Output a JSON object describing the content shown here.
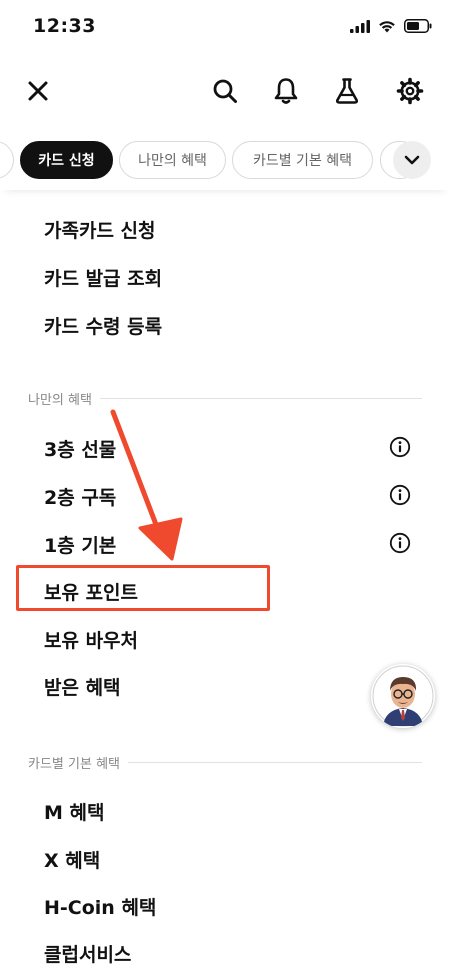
{
  "status_bar": {
    "time": "12:33"
  },
  "top_bar": {
    "icons": [
      "close-icon",
      "search-icon",
      "bell-icon",
      "flask-icon",
      "gear-icon"
    ]
  },
  "chips": {
    "items": [
      {
        "label": "카드 신청",
        "active": true
      },
      {
        "label": "나만의 혜택",
        "active": false
      },
      {
        "label": "카드별 기본 혜택",
        "active": false
      }
    ]
  },
  "menu": {
    "card_items": [
      "가족카드 신청",
      "카드 발급 조회",
      "카드 수령 등록"
    ],
    "my_benefits": {
      "title": "나만의 혜택",
      "items": [
        "3층 선물",
        "2층 구독",
        "1층 기본",
        "보유 포인트",
        "보유 바우처",
        "받은 혜택"
      ]
    },
    "card_benefits": {
      "title": "카드별 기본 혜택",
      "items": [
        "M 혜택",
        "X 혜택",
        "H-Coin 혜택",
        "클럽서비스"
      ]
    }
  },
  "colors": {
    "annotation": "#ef4a2e",
    "chip_active": "#111111"
  }
}
